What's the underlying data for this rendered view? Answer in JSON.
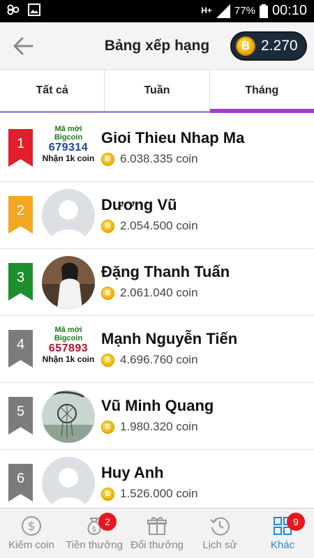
{
  "status_bar": {
    "network_label": "H+",
    "battery_text": "77%",
    "time": "00:10"
  },
  "header": {
    "title": "Bảng xếp hạng",
    "coin_symbol": "B",
    "balance": "2.270"
  },
  "tabs": [
    {
      "label": "Tất cả",
      "active": false
    },
    {
      "label": "Tuần",
      "active": false
    },
    {
      "label": "Tháng",
      "active": true
    }
  ],
  "ranking": [
    {
      "rank": "1",
      "rank_color": "#e11e2b",
      "name": "Gioi Thieu Nhap Ma",
      "coins": "6.038.335 coin",
      "avatar": "promo",
      "promo": {
        "line1": "Mã mời Bigcoin",
        "code": "679314",
        "line3": "Nhận 1k coin"
      }
    },
    {
      "rank": "2",
      "rank_color": "#f5a623",
      "name": "Dương Vũ",
      "coins": "2.054.500 coin",
      "avatar": "default"
    },
    {
      "rank": "3",
      "rank_color": "#1e8f2e",
      "name": "Đặng Thanh Tuấn",
      "coins": "2.061.040 coin",
      "avatar": "photo"
    },
    {
      "rank": "4",
      "rank_color": "#7b7b7b",
      "name": "Mạnh Nguyễn Tiến",
      "coins": "4.696.760 coin",
      "avatar": "promo",
      "promo": {
        "line1": "Mã mời Bigcoin",
        "code": "657893",
        "line3": "Nhận 1k coin"
      }
    },
    {
      "rank": "5",
      "rank_color": "#7b7b7b",
      "name": "Vũ Minh Quang",
      "coins": "1.980.320 coin",
      "avatar": "dreamcatcher"
    },
    {
      "rank": "6",
      "rank_color": "#7b7b7b",
      "name": "Huy Anh",
      "coins": "1.526.000 coin",
      "avatar": "default"
    }
  ],
  "bottom_nav": [
    {
      "label": "Kiếm coin",
      "icon": "dollar-circle-icon",
      "badge": null,
      "active": false
    },
    {
      "label": "Tiền thưởng",
      "icon": "money-bag-icon",
      "badge": "2",
      "active": false
    },
    {
      "label": "Đổi thưởng",
      "icon": "gift-icon",
      "badge": null,
      "active": false
    },
    {
      "label": "Lịch sử",
      "icon": "history-icon",
      "badge": null,
      "active": false
    },
    {
      "label": "Khác",
      "icon": "grid-icon",
      "badge": "9",
      "active": true
    }
  ],
  "colors": {
    "active_tab": "#9b3fd6",
    "active_nav": "#1e88e5",
    "badge": "#e6171d"
  }
}
